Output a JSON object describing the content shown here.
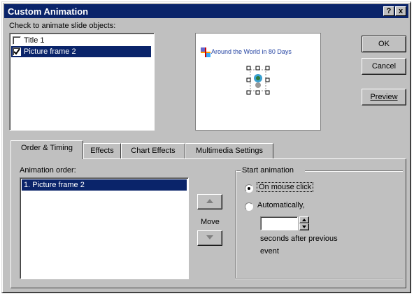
{
  "window": {
    "title": "Custom Animation",
    "help_label": "?",
    "close_label": "x"
  },
  "objects": {
    "label": "Check to animate slide objects:",
    "items": [
      {
        "label": "Title 1",
        "checked": false
      },
      {
        "label": "Picture frame 2",
        "checked": true
      }
    ]
  },
  "preview_slide": {
    "title": "Around the World in 80 Days"
  },
  "buttons": {
    "ok": "OK",
    "cancel": "Cancel",
    "preview": "Preview"
  },
  "tabs": [
    {
      "label": "Order & Timing",
      "active": true
    },
    {
      "label": "Effects",
      "active": false
    },
    {
      "label": "Chart Effects",
      "active": false
    },
    {
      "label": "Multimedia Settings",
      "active": false
    }
  ],
  "order": {
    "label": "Animation order:",
    "items": [
      "1. Picture frame 2"
    ],
    "move_label": "Move"
  },
  "start": {
    "group_label": "Start animation",
    "on_click_label": "On mouse click",
    "auto_label": "Automatically,",
    "seconds_value": "",
    "after_label_1": "seconds after previous",
    "after_label_2": "event"
  },
  "colors": {
    "title_bar": "#0a246a",
    "selection": "#0a246a"
  }
}
